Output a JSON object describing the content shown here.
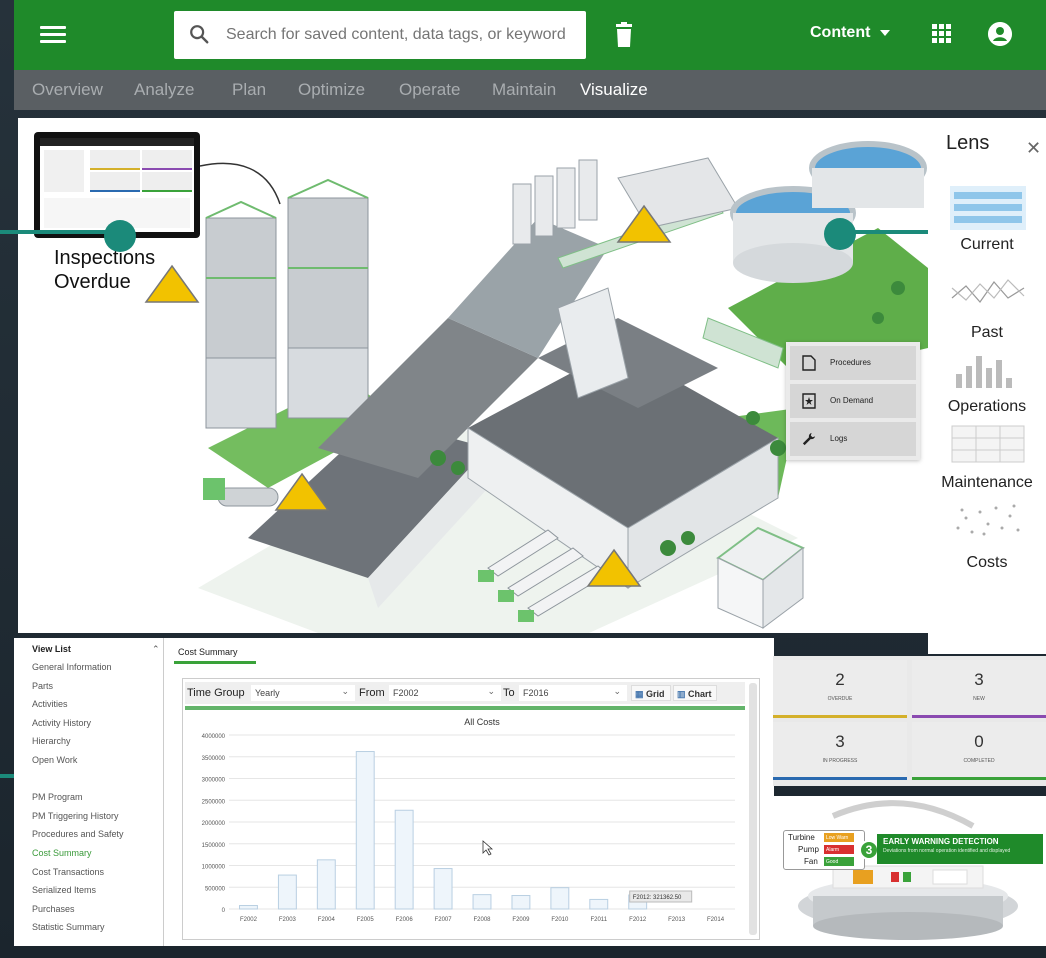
{
  "header": {
    "search_placeholder": "Search for saved content, data tags, or keywords",
    "content_label": "Content"
  },
  "nav": {
    "tabs": [
      {
        "label": "Overview"
      },
      {
        "label": "Analyze"
      },
      {
        "label": "Plan"
      },
      {
        "label": "Optimize"
      },
      {
        "label": "Operate"
      },
      {
        "label": "Maintain"
      },
      {
        "label": "Visualize",
        "active": true
      }
    ]
  },
  "scene": {
    "callout_line1": "Inspections",
    "callout_line2": "Overdue",
    "menu": [
      {
        "label": "Procedures",
        "icon": "document-icon"
      },
      {
        "label": "On Demand",
        "icon": "on-demand-icon"
      },
      {
        "label": "Logs",
        "icon": "wrench-icon"
      }
    ]
  },
  "lens": {
    "title": "Lens",
    "items": [
      {
        "label": "Current",
        "icon": "current-lens-icon"
      },
      {
        "label": "Past",
        "icon": "past-lens-icon"
      },
      {
        "label": "Operations",
        "icon": "operations-lens-icon"
      },
      {
        "label": "Maintenance",
        "icon": "maintenance-lens-icon"
      },
      {
        "label": "Costs",
        "icon": "costs-lens-icon"
      }
    ]
  },
  "viewlist": {
    "title": "View List",
    "items": [
      {
        "label": "General Information"
      },
      {
        "label": "Parts"
      },
      {
        "label": "Activities"
      },
      {
        "label": "Activity History"
      },
      {
        "label": "Hierarchy"
      },
      {
        "label": "Open Work"
      },
      {
        "label": ""
      },
      {
        "label": "PM Program"
      },
      {
        "label": "PM Triggering History"
      },
      {
        "label": "Procedures and Safety"
      },
      {
        "label": "Cost Summary",
        "active": true
      },
      {
        "label": "Cost Transactions"
      },
      {
        "label": "Serialized Items"
      },
      {
        "label": "Purchases"
      },
      {
        "label": "Statistic Summary"
      }
    ]
  },
  "cost": {
    "tab": "Cost Summary",
    "time_group_label": "Time Group",
    "time_group_value": "Yearly",
    "from_label": "From",
    "from_value": "F2002",
    "to_label": "To",
    "to_value": "F2016",
    "grid_label": "Grid",
    "chart_label": "Chart",
    "tooltip": "F2012: 321362.50"
  },
  "chart_data": {
    "type": "bar",
    "title": "All Costs",
    "categories": [
      "F2002",
      "F2003",
      "F2004",
      "F2005",
      "F2006",
      "F2007",
      "F2008",
      "F2009",
      "F2010",
      "F2011",
      "F2012",
      "F2013",
      "F2014"
    ],
    "values": [
      80000,
      780000,
      1130000,
      3620000,
      2270000,
      930000,
      330000,
      310000,
      490000,
      220000,
      321362.5,
      0,
      0
    ],
    "ylim": [
      0,
      4000000
    ],
    "yticks": [
      0,
      500000,
      1000000,
      1500000,
      2000000,
      2500000,
      3000000,
      3500000,
      4000000
    ],
    "grid": true
  },
  "stats": [
    {
      "value": "2",
      "label": "OVERDUE",
      "color": "#d4b02a"
    },
    {
      "value": "3",
      "label": "NEW",
      "color": "#8a4ab0"
    },
    {
      "value": "3",
      "label": "IN PROGRESS",
      "color": "#2a6ab0"
    },
    {
      "value": "0",
      "label": "COMPLETED",
      "color": "#3aa23a"
    }
  ],
  "ewd": {
    "title": "EARLY WARNING DETECTION",
    "subtitle": "Deviations from normal operation identified and displayed",
    "count": "3",
    "rows": [
      {
        "name": "Turbine",
        "status": "Low Warn",
        "color": "#e8a020"
      },
      {
        "name": "Pump",
        "status": "Alarm",
        "color": "#d83030"
      },
      {
        "name": "Fan",
        "status": "Good",
        "color": "#3aa23a"
      }
    ]
  },
  "colors": {
    "brand": "#1f8a2a",
    "accent_teal": "#1b8a7a",
    "warning": "#f2c200"
  }
}
